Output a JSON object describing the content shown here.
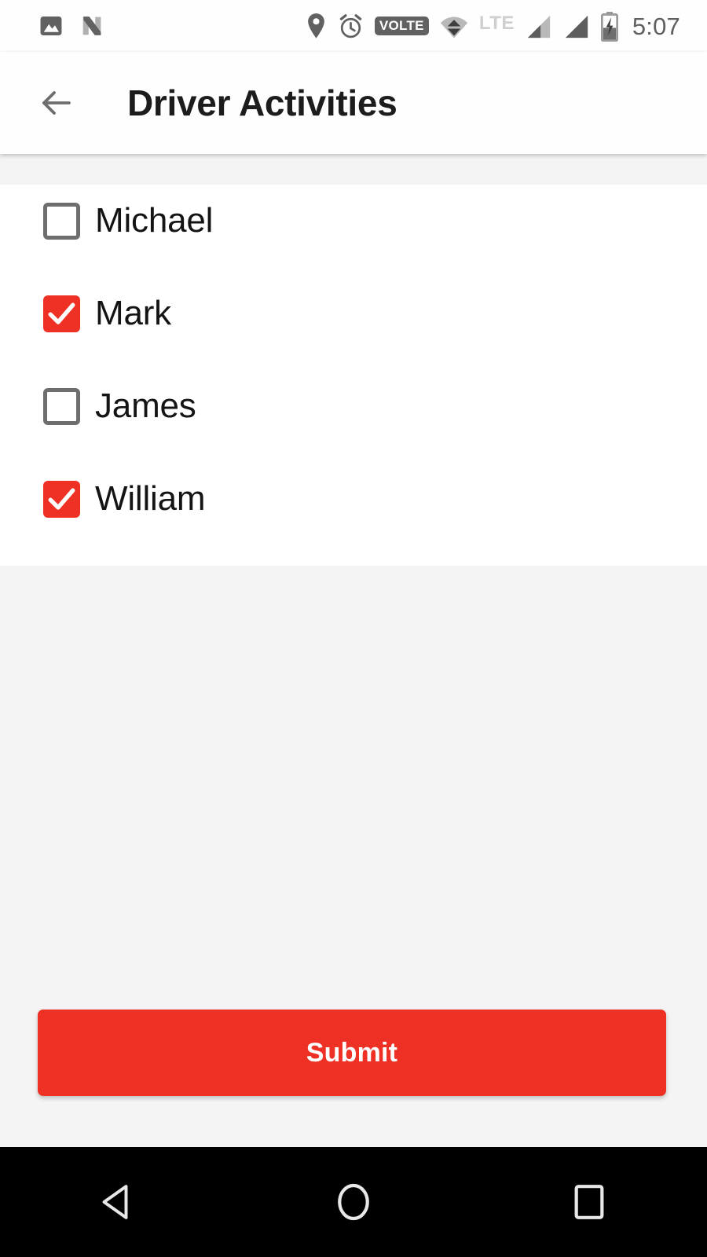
{
  "status_bar": {
    "time": "5:07",
    "volte_label": "VOLTE",
    "network_label": "LTE",
    "left_icons": [
      "photo-icon",
      "android-nougat-logo-icon"
    ],
    "right_icons": [
      "location-pin-icon",
      "alarm-clock-icon",
      "volte-badge",
      "wifi-icon",
      "signal-bars-icon-1",
      "signal-bars-icon-2",
      "battery-charging-icon"
    ],
    "icon_color": "#616161",
    "lte_color": "#cfcfcf",
    "time_color": "#5f5f5f"
  },
  "app_bar": {
    "title": "Driver Activities",
    "back_icon": "arrow-left-icon",
    "background": "#fefefe",
    "title_color": "#1c1c1c",
    "back_icon_color": "#6e6e6e"
  },
  "list": {
    "items": [
      {
        "label": "Michael",
        "checked": false
      },
      {
        "label": "Mark",
        "checked": true
      },
      {
        "label": "James",
        "checked": false
      },
      {
        "label": "William",
        "checked": true
      }
    ],
    "card_background": "#ffffff",
    "label_color": "#141414",
    "checkbox_checked_color": "#ee3124",
    "checkbox_unchecked_border_color": "#6e6e6e"
  },
  "submit": {
    "label": "Submit",
    "background": "#ee3124",
    "text_color": "#ffffff"
  },
  "nav_bar": {
    "background": "#000000",
    "buttons": [
      {
        "name": "back",
        "icon": "triangle-back-icon"
      },
      {
        "name": "home",
        "icon": "circle-home-icon"
      },
      {
        "name": "recents",
        "icon": "square-recents-icon"
      }
    ]
  },
  "page_background": "#f4f4f4"
}
